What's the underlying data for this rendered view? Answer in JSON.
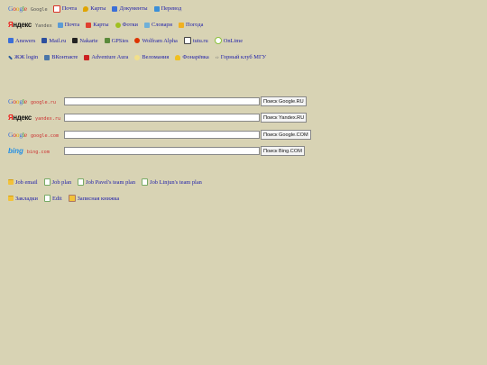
{
  "row_google": {
    "brand": [
      "G",
      "o",
      "o",
      "g",
      "l",
      "e"
    ],
    "brand_domain": "Google",
    "links": [
      {
        "label": "Почта",
        "icon": "gmail-icon",
        "color": "#d93025"
      },
      {
        "label": "Карты",
        "icon": "maps-pin-icon",
        "color": "#e0a400"
      },
      {
        "label": "Документы",
        "icon": "docs-icon",
        "color": "#3b6fd8"
      },
      {
        "label": "Перевод",
        "icon": "translate-icon",
        "color": "#3b8fd8"
      }
    ]
  },
  "row_yandex": {
    "brand_first": "Я",
    "brand_rest": "ндекс",
    "brand_domain": "Yandex",
    "links": [
      {
        "label": "Почта",
        "icon": "yandex-mail-icon",
        "color": "#5b9bd5"
      },
      {
        "label": "Карты",
        "icon": "yandex-maps-icon",
        "color": "#e04030"
      },
      {
        "label": "Фотки",
        "icon": "yandex-photos-icon",
        "color": "#a0c020"
      },
      {
        "label": "Словари",
        "icon": "yandex-dict-icon",
        "color": "#6fb0d8"
      },
      {
        "label": "Погода",
        "icon": "weather-icon",
        "color": "#f0b020"
      }
    ]
  },
  "row_services": {
    "links": [
      {
        "label": "Answers",
        "icon": "answers-icon",
        "color": "#3b6fd8"
      },
      {
        "label": "Mail.ru",
        "icon": "mailru-icon",
        "color": "#2c4f9e"
      },
      {
        "label": "Nakarte",
        "icon": "nakarte-icon",
        "color": "#222222"
      },
      {
        "label": "GPSies",
        "icon": "gpsies-icon",
        "color": "#5a8a3a"
      },
      {
        "label": "Wolfram Alpha",
        "icon": "wolfram-icon",
        "color": "#dd3300"
      },
      {
        "label": "tutu.ru",
        "icon": "tutu-icon",
        "color": "#444444"
      },
      {
        "label": "OnLime",
        "icon": "onlime-icon",
        "color": "#8ac03a"
      }
    ]
  },
  "row_social": {
    "links": [
      {
        "label": "ЖЖ login",
        "icon": "livejournal-icon",
        "color": "#2a5a9a"
      },
      {
        "label": "ВКонтакте",
        "icon": "vk-icon",
        "color": "#4a76a8"
      },
      {
        "label": "Adventure Aura",
        "icon": "adventure-aura-icon",
        "color": "#cc2222"
      },
      {
        "label": "Веломания",
        "icon": "velomania-icon",
        "color": "#f2e08a"
      },
      {
        "label": "Фонарёвка",
        "icon": "lightbulb-icon",
        "color": "#f0c020"
      },
      {
        "label": "Горный клуб МГУ",
        "icon": "double-arrow-icon",
        "color": "#666666"
      }
    ]
  },
  "searches": [
    {
      "brand_type": "google",
      "domain": "google.ru",
      "button": "Поиск Google.RU",
      "value": ""
    },
    {
      "brand_type": "yandex",
      "domain": "yandex.ru",
      "button": "Поиск Yandex.RU",
      "value": ""
    },
    {
      "brand_type": "google",
      "domain": "google.com",
      "button": "Поиск Google.COM",
      "value": ""
    },
    {
      "brand_type": "bing",
      "domain": "bing.com",
      "button": "Поиск Bing.COM",
      "value": ""
    }
  ],
  "bing_brand": "bing",
  "jobs": [
    {
      "label": "Job email",
      "icon": "email-folder-icon"
    },
    {
      "label": "Job plan",
      "icon": "plan-doc-icon"
    },
    {
      "label": "Job Pavel's team plan",
      "icon": "plan-doc-icon"
    },
    {
      "label": "Job Linjun's team plan",
      "icon": "plan-doc-icon"
    }
  ],
  "bottom": [
    {
      "label": "Закладки",
      "icon": "bookmarks-folder-icon"
    },
    {
      "label": "Edit",
      "icon": "edit-doc-icon"
    },
    {
      "label": "Записная книжка",
      "icon": "notebook-icon"
    }
  ]
}
